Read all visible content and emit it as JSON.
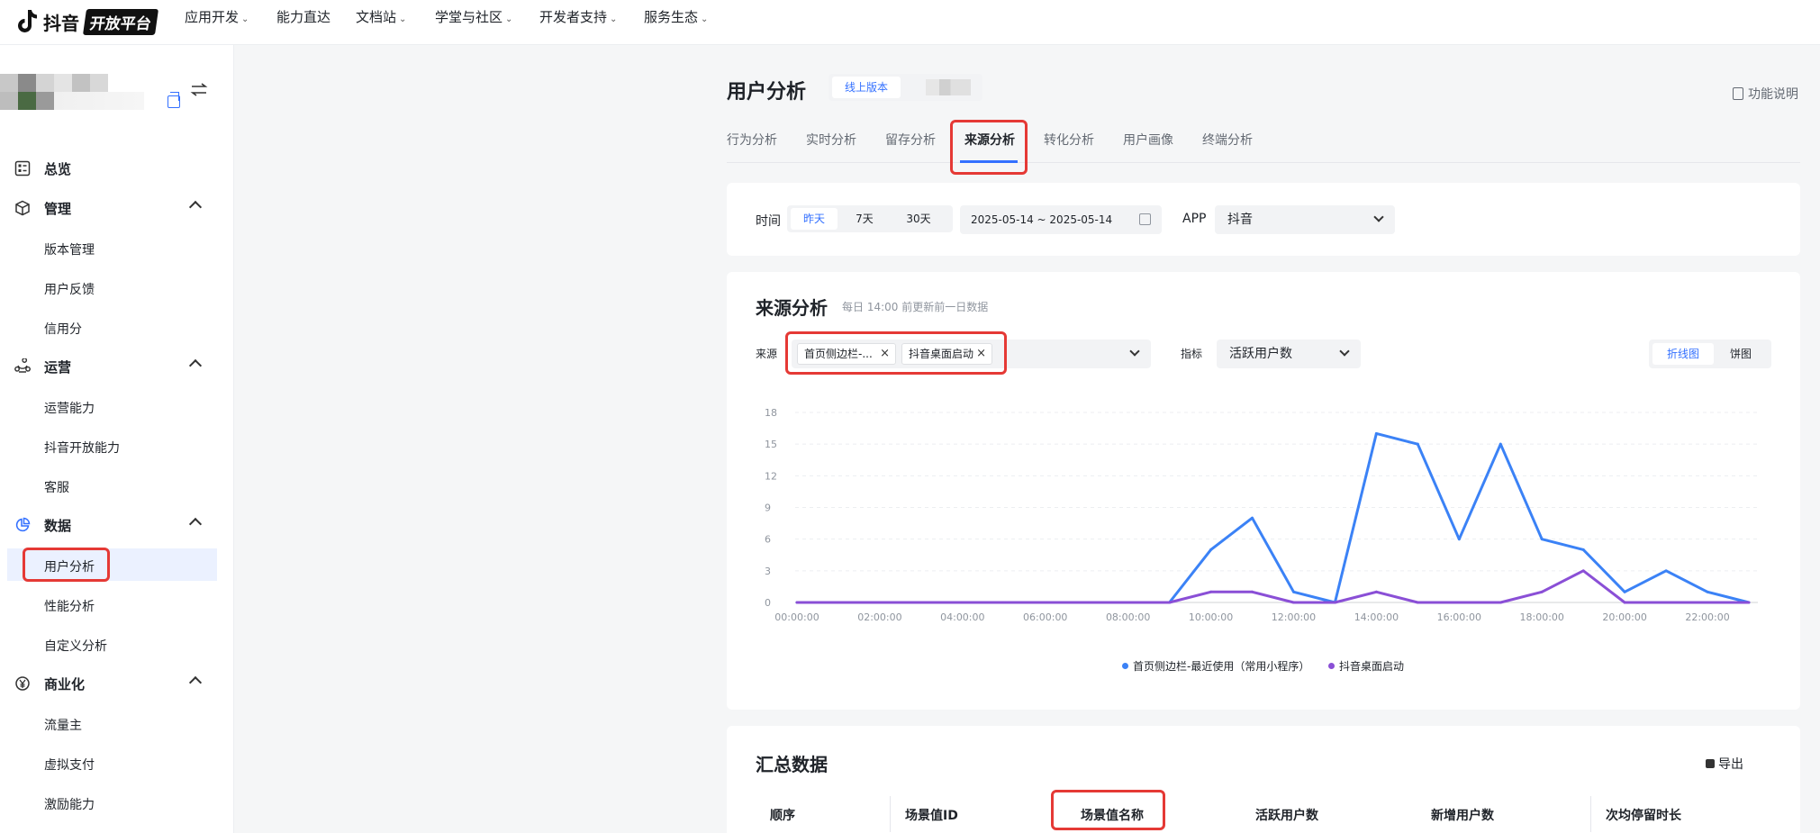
{
  "topnav": {
    "logo_text": "抖音",
    "logo_badge": "开放平台",
    "items": [
      {
        "label": "应用开发",
        "has_dropdown": true
      },
      {
        "label": "能力直达",
        "has_dropdown": false
      },
      {
        "label": "文档站",
        "has_dropdown": true
      },
      {
        "label": "学堂与社区",
        "has_dropdown": true
      },
      {
        "label": "开发者支持",
        "has_dropdown": true
      },
      {
        "label": "服务生态",
        "has_dropdown": true
      }
    ]
  },
  "sidebar": {
    "groups": [
      {
        "label": "总览",
        "icon": "dashboard-icon",
        "items": []
      },
      {
        "label": "管理",
        "icon": "box-icon",
        "items": [
          "版本管理",
          "用户反馈",
          "信用分"
        ]
      },
      {
        "label": "运营",
        "icon": "operation-icon",
        "items": [
          "运营能力",
          "抖音开放能力",
          "客服"
        ]
      },
      {
        "label": "数据",
        "icon": "pie-chart-icon",
        "items": [
          "用户分析",
          "性能分析",
          "自定义分析"
        ]
      },
      {
        "label": "商业化",
        "icon": "yen-icon",
        "items": [
          "流量主",
          "虚拟支付",
          "激励能力"
        ]
      }
    ],
    "active_item": "用户分析"
  },
  "page": {
    "title": "用户分析",
    "version_tag": "线上版本",
    "help_label": "功能说明"
  },
  "tabs": [
    "行为分析",
    "实时分析",
    "留存分析",
    "来源分析",
    "转化分析",
    "用户画像",
    "终端分析"
  ],
  "active_tab": "来源分析",
  "filters": {
    "time_label": "时间",
    "time_options": [
      "昨天",
      "7天",
      "30天"
    ],
    "time_selected": "昨天",
    "date_range": "2025-05-14 ~ 2025-05-14",
    "app_label": "APP",
    "app_value": "抖音"
  },
  "source_section": {
    "title": "来源分析",
    "subtitle": "每日 14:00 前更新前一日数据",
    "source_label": "来源",
    "source_tags": [
      "首页侧边栏-...",
      "抖音桌面启动"
    ],
    "metric_label": "指标",
    "metric_value": "活跃用户数",
    "view_options": [
      "折线图",
      "饼图"
    ],
    "view_selected": "折线图"
  },
  "chart_data": {
    "type": "line",
    "x": [
      "00:00:00",
      "01:00:00",
      "02:00:00",
      "03:00:00",
      "04:00:00",
      "05:00:00",
      "06:00:00",
      "07:00:00",
      "08:00:00",
      "09:00:00",
      "10:00:00",
      "11:00:00",
      "12:00:00",
      "13:00:00",
      "14:00:00",
      "15:00:00",
      "16:00:00",
      "17:00:00",
      "18:00:00",
      "19:00:00",
      "20:00:00",
      "21:00:00",
      "22:00:00",
      "23:00:00"
    ],
    "x_tick_labels": [
      "00:00:00",
      "02:00:00",
      "04:00:00",
      "06:00:00",
      "08:00:00",
      "10:00:00",
      "12:00:00",
      "14:00:00",
      "16:00:00",
      "18:00:00",
      "20:00:00",
      "22:00:00"
    ],
    "y_ticks": [
      0,
      3,
      6,
      9,
      12,
      15,
      18
    ],
    "ylim": [
      0,
      18
    ],
    "grid": true,
    "legend_position": "bottom",
    "series": [
      {
        "name": "首页侧边栏-最近使用（常用小程序）",
        "color": "#3b82f6",
        "values": [
          0,
          0,
          0,
          0,
          0,
          0,
          0,
          0,
          0,
          0,
          5,
          8,
          1,
          0,
          16,
          15,
          6,
          15,
          6,
          5,
          1,
          3,
          1,
          0
        ]
      },
      {
        "name": "抖音桌面启动",
        "color": "#8a4fd6",
        "values": [
          0,
          0,
          0,
          0,
          0,
          0,
          0,
          0,
          0,
          0,
          1,
          1,
          0,
          0,
          1,
          0,
          0,
          0,
          1,
          3,
          0,
          0,
          0,
          0
        ]
      }
    ]
  },
  "summary_section": {
    "title": "汇总数据",
    "export_label": "导出",
    "columns": [
      "顺序",
      "场景值ID",
      "场景值名称",
      "活跃用户数",
      "新增用户数",
      "次均停留时长"
    ]
  },
  "colors": {
    "accent": "#3370ff",
    "highlight_box": "#e53935"
  }
}
